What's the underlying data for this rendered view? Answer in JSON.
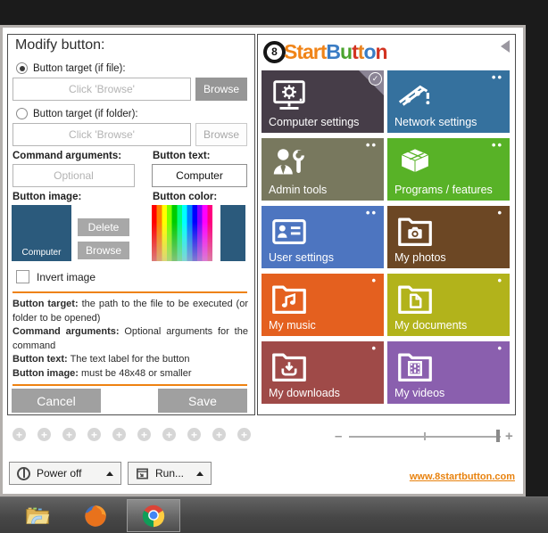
{
  "modify_panel": {
    "title": "Modify button:",
    "file_radio_label": "Button target (if file):",
    "folder_radio_label": "Button target (if folder):",
    "file_target_placeholder": "Click 'Browse'",
    "folder_target_placeholder": "Click 'Browse'",
    "file_browse_label": "Browse",
    "folder_browse_label": "Browse",
    "command_arguments_label": "Command arguments:",
    "command_arguments_placeholder": "Optional",
    "button_text_label": "Button text:",
    "button_text_value": "Computer",
    "button_image_label": "Button image:",
    "image_preview_caption": "Computer",
    "image_preview_color": "#2b5a7c",
    "delete_button_label": "Delete",
    "image_browse_label": "Browse",
    "button_color_label": "Button color:",
    "selected_color": "#2b5a7c",
    "invert_image_label": "Invert image",
    "separator_color": "#ee8211",
    "help": [
      {
        "term": "Button target:",
        "desc": "the path to the file to be executed (or folder to be opened)"
      },
      {
        "term": "Command arguments:",
        "desc": "Optional arguments for the command"
      },
      {
        "term": "Button text:",
        "desc": "The text label for the button"
      },
      {
        "term": "Button image:",
        "desc": "must be 48x48 or smaller"
      }
    ],
    "cancel_label": "Cancel",
    "save_label": "Save"
  },
  "start_panel": {
    "logo": {
      "eight": "8",
      "start_text": "Start",
      "start_color": "#f08418",
      "button_letters": [
        {
          "ch": "B",
          "color": "#3a7cc4"
        },
        {
          "ch": "u",
          "color": "#4aa32d"
        },
        {
          "ch": "t",
          "color": "#d23321"
        },
        {
          "ch": "t",
          "color": "#e8821e"
        },
        {
          "ch": "o",
          "color": "#3a7cc4"
        },
        {
          "ch": "n",
          "color": "#d23321"
        }
      ]
    },
    "tiles": [
      {
        "label": "Computer settings",
        "color": "#463d48",
        "icon": "computer-settings",
        "badge": "check"
      },
      {
        "label": "Network settings",
        "color": "#35719e",
        "icon": "network-settings",
        "badge": "••"
      },
      {
        "label": "Admin tools",
        "color": "#78785e",
        "icon": "admin-tools",
        "badge": "••"
      },
      {
        "label": "Programs / features",
        "color": "#58b227",
        "icon": "programs-features",
        "badge": "••"
      },
      {
        "label": "User settings",
        "color": "#4d75c0",
        "icon": "user-settings",
        "badge": "••"
      },
      {
        "label": "My photos",
        "color": "#6c4724",
        "icon": "my-photos",
        "badge": "•"
      },
      {
        "label": "My music",
        "color": "#e4601f",
        "icon": "my-music",
        "badge": "•"
      },
      {
        "label": "My documents",
        "color": "#b2b31b",
        "icon": "my-documents",
        "badge": "•"
      },
      {
        "label": "My downloads",
        "color": "#9f4a48",
        "icon": "my-downloads",
        "badge": "•"
      },
      {
        "label": "My videos",
        "color": "#8a5fae",
        "icon": "my-videos",
        "badge": "•"
      }
    ]
  },
  "footer": {
    "add_slot_count": 10,
    "add_slot_symbol": "+",
    "zoom_minus": "–",
    "zoom_plus": "+",
    "power_button_label": "Power off",
    "run_button_label": "Run...",
    "website_link": "www.8startbutton.com",
    "link_color": "#e8820e"
  },
  "taskbar": {
    "icons": [
      "windows-explorer",
      "firefox",
      "chrome"
    ],
    "active_icon": "chrome"
  }
}
